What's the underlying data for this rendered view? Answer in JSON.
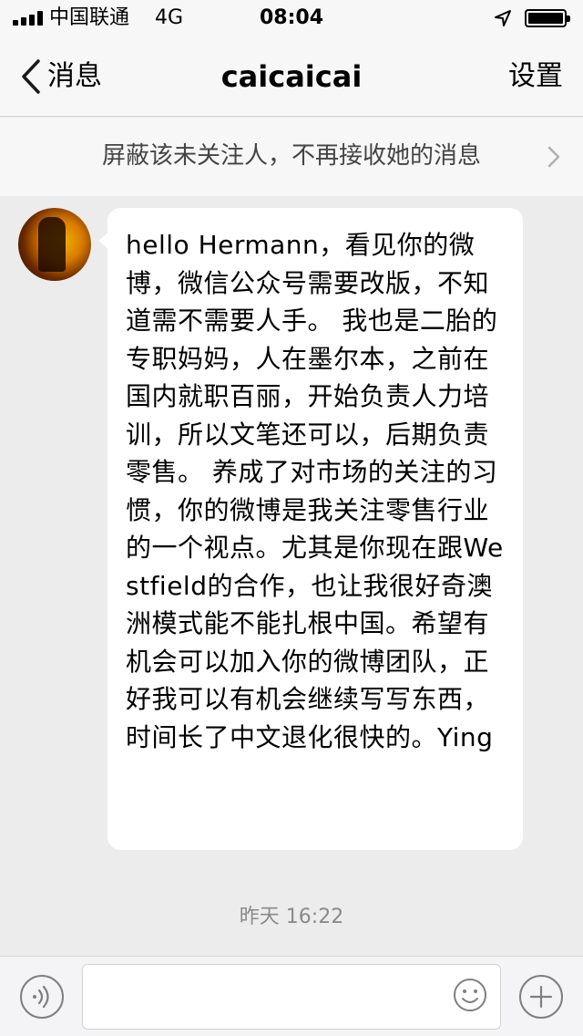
{
  "status_bar": {
    "carrier": "中国联通",
    "network": "4G",
    "time": "08:04",
    "icons": [
      "signal-icon",
      "location-icon",
      "battery-icon"
    ]
  },
  "nav": {
    "back_label": "消息",
    "title": "caicaicai",
    "settings_label": "设置"
  },
  "banner": {
    "text": "屏蔽该未关注人，不再接收她的消息"
  },
  "message": {
    "text": "hello Hermann，看见你的微博，微信公众号需要改版，不知道需不需要人手。 我也是二胎的专职妈妈，人在墨尔本，之前在国内就职百丽，开始负责人力培训，所以文笔还可以，后期负责零售。 养成了对市场的关注的习惯，你的微博是我关注零售行业的一个视点。尤其是你现在跟Westfield的合作，也让我很好奇澳洲模式能不能扎根中国。希望有机会可以加入你的微博团队，正好我可以有机会继续写写东西，时间长了中文退化很快的。Ying",
    "timestamp": "昨天 16:22"
  },
  "input_bar": {
    "value": "",
    "placeholder": "",
    "icons": [
      "voice-icon",
      "emoji-icon",
      "plus-icon"
    ]
  },
  "colors": {
    "background": "#ececec",
    "bar": "#f7f7f7",
    "bubble": "#ffffff",
    "muted_text": "#8a8a8a"
  }
}
